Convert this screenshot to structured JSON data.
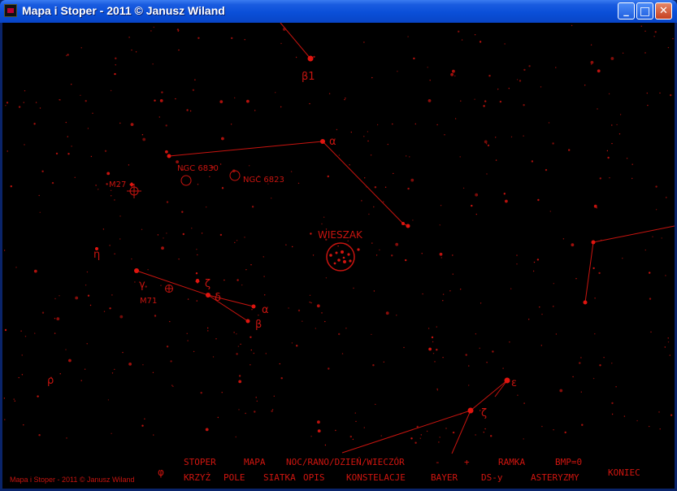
{
  "window": {
    "title": "Mapa i Stoper - 2011 © Janusz Wiland",
    "buttons": {
      "minimize": "_",
      "maximize": "□",
      "close": "✕"
    }
  },
  "map": {
    "colors": {
      "background": "#000000",
      "stars": "#d0140f",
      "lines": "#c8140f"
    },
    "labels": {
      "beta1_top": "β1",
      "alpha_vul": "α",
      "ngc6830": "NGC 6830",
      "ngc6823": "NGC 6823",
      "m27": "M27",
      "wieszak": "WIESZAK",
      "eta": "η",
      "gamma": "γ",
      "zeta_sge": "ζ",
      "delta": "δ",
      "alpha_sge": "α",
      "beta_sge": "β",
      "m71": "M71",
      "rho": "ρ",
      "epsilon": "ε",
      "zeta_bottom": "ζ",
      "phi": "φ"
    }
  },
  "menu": {
    "row1": [
      "STOPER",
      "MAPA",
      "NOC/RANO/DZIEŃ/WIECZÓR",
      "-",
      "+",
      "RAMKA",
      "BMP=0"
    ],
    "row2": [
      "KRZYŻ",
      "POLE",
      "SIATKA",
      "OPIS",
      "KONSTELACJE",
      "BAYER",
      "DS-y",
      "ASTERYZMY"
    ],
    "exit": "KONIEC"
  },
  "footer": "Mapa i Stoper - 2011 © Janusz Wiland"
}
